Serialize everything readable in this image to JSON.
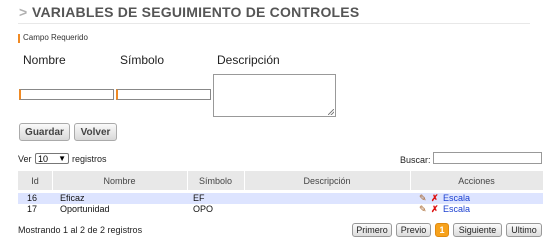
{
  "header": {
    "arrow": ">",
    "title": "VARIABLES DE SEGUIMIENTO DE CONTROLES"
  },
  "form": {
    "required_note": "Campo Requerido",
    "fields": {
      "nombre_label": "Nombre",
      "simbolo_label": "Símbolo",
      "descripcion_label": "Descripción",
      "nombre_value": "",
      "simbolo_value": "",
      "descripcion_value": ""
    },
    "buttons": {
      "save": "Guardar",
      "back": "Volver"
    }
  },
  "table_controls": {
    "show_prefix": "Ver",
    "page_size": "10",
    "show_suffix": "registros",
    "search_label": "Buscar:",
    "search_value": ""
  },
  "table": {
    "columns": [
      "Id",
      "Nombre",
      "Símbolo",
      "Descripción",
      "Acciones"
    ],
    "rows": [
      {
        "id": "16",
        "nombre": "Eficaz",
        "simbolo": "EF",
        "descripcion": "",
        "action_link": "Escala"
      },
      {
        "id": "17",
        "nombre": "Oportunidad",
        "simbolo": "OPO",
        "descripcion": "",
        "action_link": "Escala"
      }
    ]
  },
  "footer": {
    "info": "Mostrando 1 al 2 de 2 registros",
    "pagination": {
      "first": "Primero",
      "prev": "Previo",
      "current": "1",
      "next": "Siguiente",
      "last": "Ultimo"
    }
  },
  "colors": {
    "accent": "#f7a21c",
    "link": "#1a3fd0",
    "row_highlight": "#dde4ff"
  },
  "icons": {
    "edit": "pencil-icon",
    "delete": "delete-x-icon"
  }
}
